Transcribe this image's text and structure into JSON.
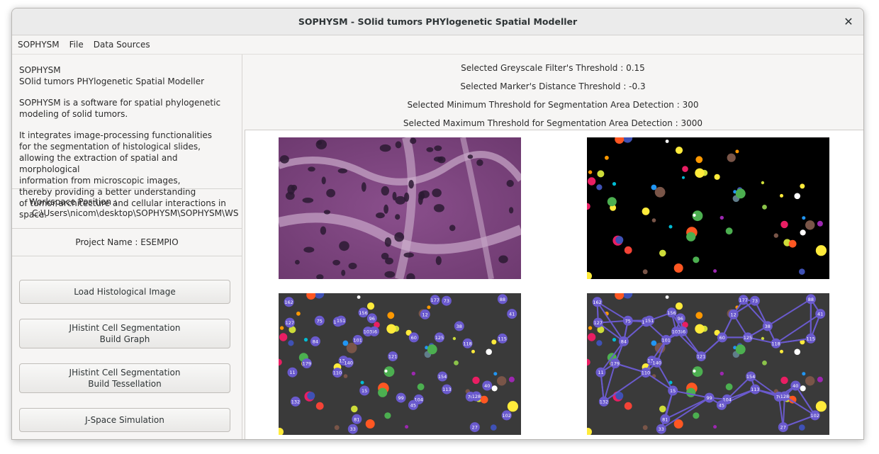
{
  "window": {
    "title": "SOPHYSM - SOlid tumors PHYlogenetic Spatial Modeller"
  },
  "menu": [
    "SOPHYSM",
    "File",
    "Data Sources"
  ],
  "about": {
    "name": "SOPHYSM",
    "subtitle": "SOlid tumors PHYlogenetic Spatial Modeller",
    "desc1": "SOPHYSM is a software for spatial phylogenetic\nmodeling of solid tumors.",
    "desc2": "It integrates image-processing functionalities\nfor the segmentation of histological slides,\nallowing the extraction of spatial and morphological\ninformation from microscopic images,\nthereby providing a better understanding\nof tumor architecture and cellular interactions in space."
  },
  "workspace": {
    "label": "Workspace Position :",
    "path": "C:\\Users\\nicom\\desktop\\SOPHYSM\\SOPHYSM\\WS"
  },
  "project": {
    "label": "Project Name : ESEMPIO"
  },
  "buttons": {
    "load": "Load Histological Image",
    "graph_line1": "JHistint Cell Segmentation",
    "graph_line2": "Build Graph",
    "tess_line1": "JHistint Cell Segmentation",
    "tess_line2": "Build Tessellation",
    "jspace": "J-Space Simulation"
  },
  "thresholds": [
    "Selected Greyscale Filter's Threshold : 0.15",
    "Selected Marker's Distance Threshold : -0.3",
    "Selected Minimum Threshold for Segmentation Area Detection : 300",
    "Selected Maximum Threshold for Segmentation Area Detection : 3000"
  ],
  "graph_node_labels": [
    "177",
    "127",
    "33",
    "162",
    "110",
    "12",
    "138",
    "179",
    "11",
    "113",
    "115",
    "40",
    "73",
    "84",
    "99",
    "104",
    "102",
    "108",
    "125",
    "118",
    "56",
    "81",
    "88",
    "101",
    "27",
    "38",
    "15",
    "45",
    "60",
    "70",
    "128",
    "154",
    "132",
    "41",
    "121",
    "96",
    "103",
    "151",
    "75",
    "140",
    "156"
  ],
  "colors": {
    "node": "#6a5acd",
    "edge": "#6a5acd",
    "panel_bg": "#3a3a3a"
  }
}
